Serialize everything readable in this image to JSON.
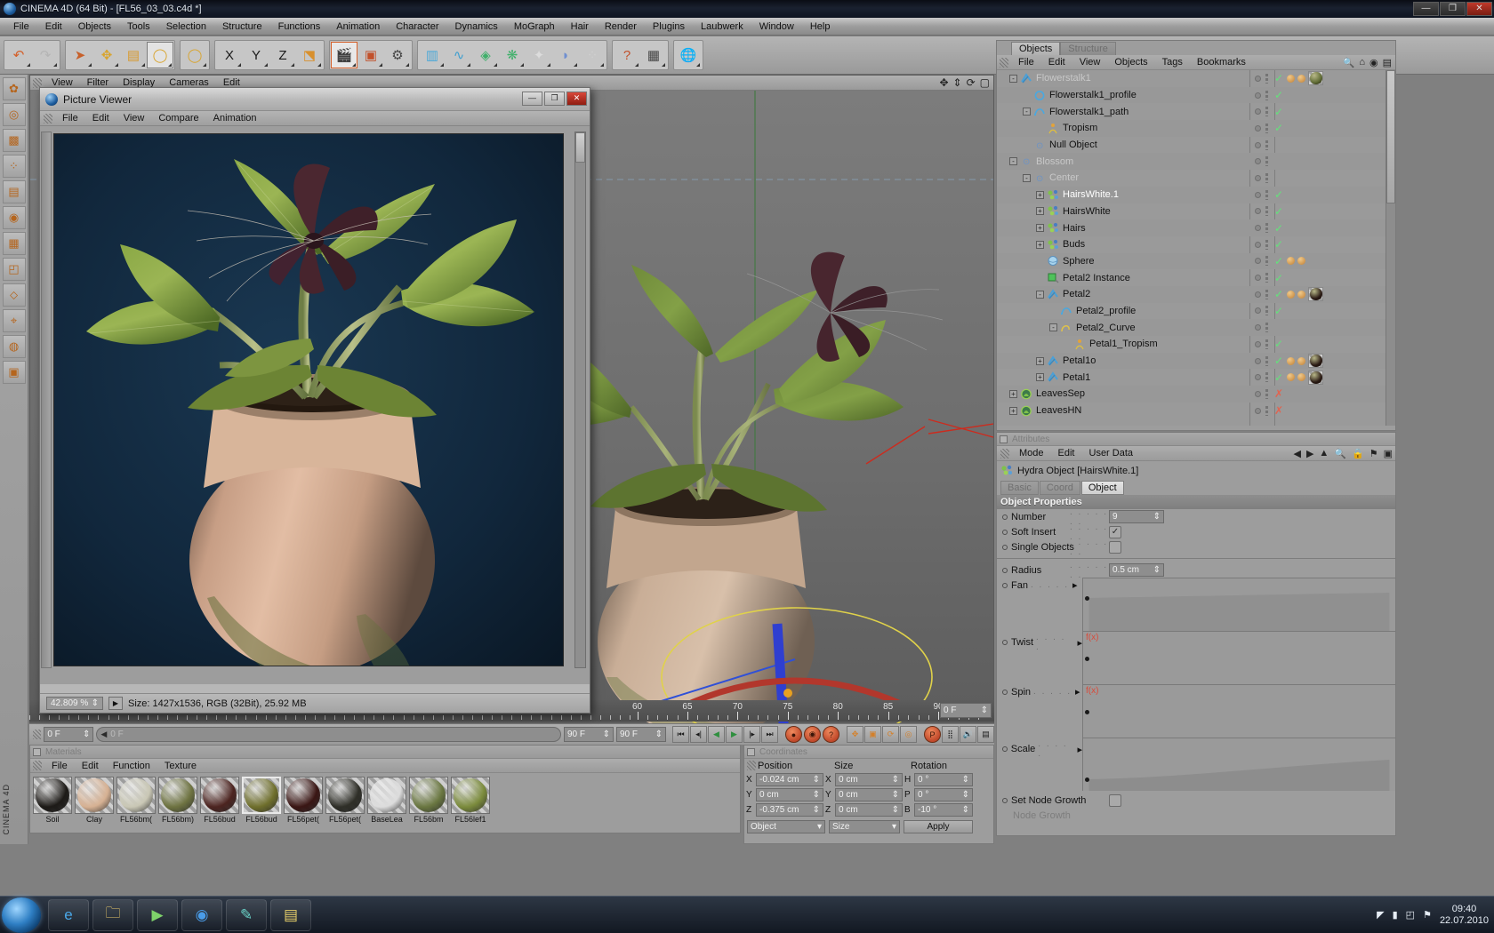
{
  "window": {
    "title": "CINEMA 4D (64 Bit) - [FL56_03_03.c4d *]",
    "btn_minimize": "—",
    "btn_maximize": "❐",
    "btn_close": "✕"
  },
  "menubar": {
    "items": [
      "File",
      "Edit",
      "Objects",
      "Tools",
      "Selection",
      "Structure",
      "Functions",
      "Animation",
      "Character",
      "Dynamics",
      "MoGraph",
      "Hair",
      "Render",
      "Plugins",
      "Laubwerk",
      "Window",
      "Help"
    ]
  },
  "toolbar": {
    "groups": [
      {
        "name": "history",
        "buttons": [
          {
            "icon": "undo-icon",
            "label": "Undo",
            "state": "normal"
          },
          {
            "icon": "redo-icon",
            "label": "Redo",
            "state": "disabled"
          }
        ]
      },
      {
        "name": "tools",
        "buttons": [
          {
            "icon": "live-selection-icon",
            "label": "Live Selection",
            "state": "normal"
          },
          {
            "icon": "move-icon",
            "label": "Move",
            "state": "normal"
          },
          {
            "icon": "scale-icon",
            "label": "Scale",
            "state": "normal"
          },
          {
            "icon": "rotate-icon",
            "label": "Rotate",
            "state": "active"
          }
        ]
      },
      {
        "name": "tools2",
        "buttons": [
          {
            "icon": "rotate-alt-icon",
            "label": "Rotate Alt",
            "state": "normal"
          }
        ]
      },
      {
        "name": "axis",
        "buttons": [
          {
            "icon": "axis-x-icon",
            "label": "X",
            "state": "normal"
          },
          {
            "icon": "axis-y-icon",
            "label": "Y",
            "state": "normal"
          },
          {
            "icon": "axis-z-icon",
            "label": "Z",
            "state": "normal"
          },
          {
            "icon": "world-coords-icon",
            "label": "World/Object",
            "state": "normal"
          }
        ]
      },
      {
        "name": "render",
        "buttons": [
          {
            "icon": "render-view-icon",
            "label": "Render View",
            "state": "hot"
          },
          {
            "icon": "render-region-icon",
            "label": "Render Region",
            "state": "normal"
          },
          {
            "icon": "render-settings-icon",
            "label": "Render Settings",
            "state": "normal"
          }
        ]
      },
      {
        "name": "objects",
        "buttons": [
          {
            "icon": "cube-primitive-icon",
            "label": "Add Cube",
            "state": "normal"
          },
          {
            "icon": "spline-icon",
            "label": "Add Spline",
            "state": "normal"
          },
          {
            "icon": "nurbs-icon",
            "label": "NURBS",
            "state": "normal"
          },
          {
            "icon": "array-icon",
            "label": "Array",
            "state": "normal"
          },
          {
            "icon": "deformer-icon",
            "label": "Deformer",
            "state": "normal"
          },
          {
            "icon": "light-icon",
            "label": "Light",
            "state": "normal"
          },
          {
            "icon": "particles-icon",
            "label": "Particles",
            "state": "normal"
          }
        ]
      },
      {
        "name": "help",
        "buttons": [
          {
            "icon": "help-cursor-icon",
            "label": "Help",
            "state": "normal"
          },
          {
            "icon": "layout-icon",
            "label": "Layout",
            "state": "normal"
          }
        ]
      },
      {
        "name": "web",
        "buttons": [
          {
            "icon": "globe-icon",
            "label": "Web",
            "state": "normal"
          }
        ]
      }
    ]
  },
  "viewport": {
    "menu": [
      "Edit",
      "Cameras",
      "Display",
      "Filter",
      "View"
    ],
    "corner_icons": [
      "move-view-icon",
      "pan-view-icon",
      "rotate-view-icon",
      "maximize-view-icon"
    ],
    "ruler_labels": [
      "60",
      "65",
      "70",
      "75",
      "80",
      "85",
      "90"
    ],
    "frame_field": "0 F"
  },
  "picture_viewer": {
    "title": "Picture Viewer",
    "menu": [
      "File",
      "Edit",
      "View",
      "Compare",
      "Animation"
    ],
    "btn_minimize": "—",
    "btn_maximize": "❐",
    "btn_close": "✕",
    "zoom": "42.809 %",
    "play_icon": "play-icon",
    "status": "Size: 1427x1536, RGB (32Bit), 25.92 MB"
  },
  "timeline": {
    "frame_start": "0 F",
    "frame_current": "0 F",
    "frame_end": "90 F",
    "frame_range": "90 F",
    "ticks": [
      "60",
      "65",
      "70",
      "75",
      "80",
      "85",
      "90"
    ],
    "transport": [
      "go-to-start-icon",
      "step-back-icon",
      "play-back-icon",
      "play-forward-icon",
      "step-forward-icon",
      "go-to-end-icon"
    ],
    "record_buttons": [
      "record-icon",
      "autokey-icon",
      "keyframe-selection-icon"
    ],
    "key_toggles": [
      "position-key-icon",
      "scale-key-icon",
      "rotation-key-icon",
      "param-key-icon"
    ],
    "extra_buttons": [
      "point-level-anim-icon",
      "dope-sheet-icon",
      "sound-icon",
      "preview-icon"
    ]
  },
  "materials": {
    "panel_title": "Materials",
    "menu": [
      "File",
      "Edit",
      "Function",
      "Texture"
    ],
    "items": [
      {
        "name": "Soil",
        "color": "#1d1a17",
        "selected": false
      },
      {
        "name": "Clay",
        "color": "#d6b193",
        "selected": false
      },
      {
        "name": "FL56bm(",
        "color": "#c9c7b5",
        "selected": false
      },
      {
        "name": "FL56bm)",
        "color": "#6e7341",
        "selected": false
      },
      {
        "name": "FL56bud",
        "color": "#4c2420",
        "selected": false
      },
      {
        "name": "FL56bud",
        "color": "#6f6f2c",
        "selected": true
      },
      {
        "name": "FL56pet(",
        "color": "#3a1614",
        "selected": false
      },
      {
        "name": "FL56pet(",
        "color": "#2f2f28",
        "selected": false
      },
      {
        "name": "BaseLea",
        "color": "#dcdcdc",
        "selected": false
      },
      {
        "name": "FL56bm",
        "color": "#6a7741",
        "selected": false
      },
      {
        "name": "FL56lef1",
        "color": "#7b8b3c",
        "selected": false
      }
    ]
  },
  "coordinates": {
    "panel_title": "Coordinates",
    "columns": [
      "Position",
      "Size",
      "Rotation"
    ],
    "rows": [
      {
        "axis": "X",
        "position": "-0.024 cm",
        "size_axis": "X",
        "size": "0 cm",
        "rot_axis": "H",
        "rotation": "0 °"
      },
      {
        "axis": "Y",
        "position": "0 cm",
        "size_axis": "Y",
        "size": "0 cm",
        "rot_axis": "P",
        "rotation": "0 °"
      },
      {
        "axis": "Z",
        "position": "-0.375 cm",
        "size_axis": "Z",
        "size": "0 cm",
        "rot_axis": "B",
        "rotation": "-10 °"
      }
    ],
    "mode_object": "Object",
    "mode_size": "Size",
    "apply": "Apply"
  },
  "object_manager": {
    "tabs": [
      {
        "label": "Objects",
        "active": true
      },
      {
        "label": "Structure",
        "active": false
      }
    ],
    "menu": [
      "File",
      "Edit",
      "View",
      "Objects",
      "Tags",
      "Bookmarks"
    ],
    "right_icons": [
      "search-icon",
      "home-icon",
      "eye-icon",
      "layout-icon"
    ],
    "tree": [
      {
        "name": "Flowerstalk1",
        "indent": 0,
        "expander": "-",
        "icon": "sweep-nurbs-icon",
        "dim": true,
        "check": "green",
        "tags": [
          "ball",
          "ball",
          "mat-olive"
        ]
      },
      {
        "name": "Flowerstalk1_profile",
        "indent": 1,
        "expander": "",
        "icon": "circle-spline-icon",
        "dim": false,
        "check": "green",
        "tags": []
      },
      {
        "name": "Flowerstalk1_path",
        "indent": 1,
        "expander": "-",
        "icon": "spline-icon",
        "dim": false,
        "check": "green",
        "tags": []
      },
      {
        "name": "Tropism",
        "indent": 2,
        "expander": "",
        "icon": "tropism-icon",
        "dim": false,
        "check": "green",
        "tags": []
      },
      {
        "name": "Null Object",
        "indent": 1,
        "expander": "",
        "icon": "null-icon",
        "dim": false,
        "check": "none",
        "tags": []
      },
      {
        "name": "Blossom",
        "indent": 0,
        "expander": "-",
        "icon": "null-icon",
        "dim": true,
        "check": "none",
        "tags": []
      },
      {
        "name": "Center",
        "indent": 1,
        "expander": "-",
        "icon": "null-icon",
        "dim": true,
        "check": "none",
        "tags": []
      },
      {
        "name": "HairsWhite.1",
        "indent": 2,
        "expander": "+",
        "icon": "hydra-icon",
        "dim": false,
        "selected": true,
        "check": "green",
        "tags": []
      },
      {
        "name": "HairsWhite",
        "indent": 2,
        "expander": "+",
        "icon": "hydra-icon",
        "dim": false,
        "check": "green",
        "tags": []
      },
      {
        "name": "Hairs",
        "indent": 2,
        "expander": "+",
        "icon": "hydra-icon",
        "dim": false,
        "check": "green",
        "tags": []
      },
      {
        "name": "Buds",
        "indent": 2,
        "expander": "+",
        "icon": "hydra-icon",
        "dim": false,
        "check": "green",
        "tags": []
      },
      {
        "name": "Sphere",
        "indent": 2,
        "expander": "",
        "icon": "sphere-icon",
        "dim": false,
        "check": "green",
        "tags": [
          "ball",
          "ball"
        ]
      },
      {
        "name": "Petal2 Instance",
        "indent": 2,
        "expander": "",
        "icon": "instance-icon",
        "dim": false,
        "check": "green",
        "tags": []
      },
      {
        "name": "Petal2",
        "indent": 2,
        "expander": "-",
        "icon": "sweep-nurbs-icon",
        "dim": false,
        "check": "green",
        "tags": [
          "ball",
          "ball",
          "mat-dark"
        ]
      },
      {
        "name": "Petal2_profile",
        "indent": 3,
        "expander": "",
        "icon": "spline-icon",
        "dim": false,
        "check": "green",
        "tags": []
      },
      {
        "name": "Petal2_Curve",
        "indent": 3,
        "expander": "-",
        "icon": "curve-icon",
        "dim": false,
        "check": "none",
        "tags": []
      },
      {
        "name": "Petal1_Tropism",
        "indent": 4,
        "expander": "",
        "icon": "tropism-icon",
        "dim": false,
        "check": "green",
        "tags": []
      },
      {
        "name": "Petal1o",
        "indent": 2,
        "expander": "+",
        "icon": "sweep-nurbs-icon",
        "dim": false,
        "check": "green",
        "tags": [
          "ball",
          "ball",
          "mat-dark"
        ]
      },
      {
        "name": "Petal1",
        "indent": 2,
        "expander": "+",
        "icon": "sweep-nurbs-icon",
        "dim": false,
        "check": "green",
        "tags": [
          "ball",
          "ball",
          "mat-dark"
        ]
      },
      {
        "name": "LeavesSep",
        "indent": 0,
        "expander": "+",
        "icon": "laubwerk-icon",
        "dim": false,
        "check": "red",
        "tags": []
      },
      {
        "name": "LeavesHN",
        "indent": 0,
        "expander": "+",
        "icon": "laubwerk-icon",
        "dim": false,
        "check": "red",
        "tags": []
      }
    ]
  },
  "attributes": {
    "panel_title": "Attributes",
    "menu": [
      "Mode",
      "Edit",
      "User Data"
    ],
    "right_icons": [
      "back-arrow-icon",
      "forward-arrow-icon",
      "up-arrow-icon",
      "search-icon",
      "lock-icon",
      "pin-icon",
      "close-icon"
    ],
    "object_title": "Hydra Object [HairsWhite.1]",
    "object_icon": "hydra-icon",
    "tabs": [
      {
        "label": "Basic",
        "active": false
      },
      {
        "label": "Coord",
        "active": false
      },
      {
        "label": "Object",
        "active": true
      }
    ],
    "section_title": "Object Properties",
    "properties": [
      {
        "label": "Number",
        "type": "number",
        "value": "9"
      },
      {
        "label": "Soft Insert",
        "type": "checkbox",
        "value": true
      },
      {
        "label": "Single Objects",
        "type": "checkbox",
        "value": false
      },
      {
        "label": "Radius",
        "type": "number",
        "value": "0.5 cm"
      }
    ],
    "curves": [
      {
        "label": "Fan",
        "fx": ""
      },
      {
        "label": "Twist",
        "fx": "f(x)"
      },
      {
        "label": "Spin",
        "fx": "f(x)"
      },
      {
        "label": "Scale",
        "fx": ""
      }
    ],
    "node_growth": {
      "label": "Set Node Growth",
      "checked": false
    },
    "node_growth_sub": "Node Growth"
  },
  "rail": {
    "buttons": [
      "model-mode-icon",
      "texture-mode-icon",
      "object-axis-icon",
      "point-mode-icon",
      "edge-mode-icon",
      "polygon-mode-icon",
      "animation-mode-icon",
      "workplane-icon",
      "uv-points-icon",
      "uv-polygons-icon",
      "texture-axis-icon",
      "laubwerk-icon"
    ],
    "vertical_label": "CINEMA 4D"
  },
  "taskbar": {
    "start_label": "start-orb",
    "items": [
      "ie-icon",
      "explorer-icon",
      "media-player-icon",
      "browser-icon",
      "paint-icon",
      "notes-icon"
    ],
    "tray_icons": [
      "show-desktop-icon",
      "network-icon",
      "volume-icon",
      "flag-icon"
    ],
    "clock_time": "09:40",
    "clock_date": "22.07.2010"
  },
  "colors": {
    "accent_orange": "#d4602a",
    "check_green": "#63e27a",
    "cross_red": "#e2634f",
    "fx_red": "#d94a3a",
    "panel_gray": "#9d9d9d"
  }
}
